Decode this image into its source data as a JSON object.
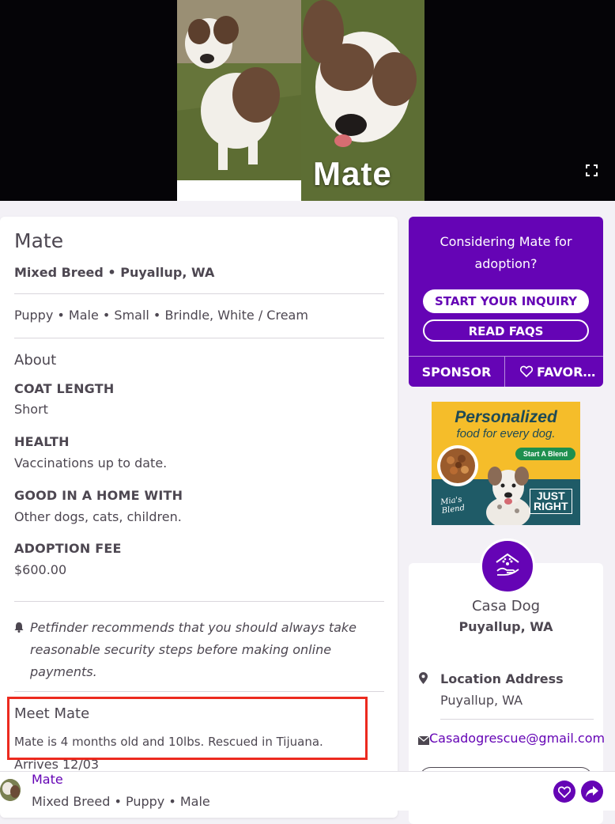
{
  "hero": {
    "name": "Mate"
  },
  "pet": {
    "name": "Mate",
    "breed_location": "Mixed Breed •  Puyallup, WA",
    "traits": "Puppy •  Male •  Small •  Brindle, White / Cream"
  },
  "about": {
    "heading": "About",
    "attributes": [
      {
        "label": "COAT LENGTH",
        "value": "Short"
      },
      {
        "label": "HEALTH",
        "value": "Vaccinations up to date."
      },
      {
        "label": "GOOD IN A HOME WITH",
        "value": "Other dogs, cats, children."
      },
      {
        "label": "ADOPTION FEE",
        "value": "$600.00"
      }
    ]
  },
  "notice": "Petfinder recommends that you should always take reasonable security steps before making online payments.",
  "meet": {
    "heading": "Meet Mate",
    "description": "Mate is 4 months old and 10lbs. Rescued in Tijuana.",
    "arrives": "Arrives 12/03"
  },
  "cta": {
    "question": "Considering Mate for adoption?",
    "inquiry_label": "START YOUR INQUIRY",
    "faqs_label": "READ FAQS",
    "sponsor_label": "SPONSOR",
    "favorite_label": "FAVORITE"
  },
  "ad": {
    "title": "Personalized",
    "subtitle": "food for every dog.",
    "button": "Start A Blend",
    "blend_line1": "Mia's",
    "blend_line2": "Blend",
    "brand_line1": "JUST",
    "brand_line2": "RIGHT"
  },
  "org": {
    "name": "Casa Dog",
    "location": "Puyallup, WA",
    "address_label": "Location Address",
    "address_value": "Puyallup, WA",
    "email": "Casadogrescue@gmail.com"
  },
  "footer": {
    "name": "Mate",
    "meta": "Mixed Breed •  Puppy •  Male"
  },
  "colors": {
    "brand_purple": "#6504b5",
    "highlight_red": "#ec2a1f",
    "text": "#4d4751"
  }
}
